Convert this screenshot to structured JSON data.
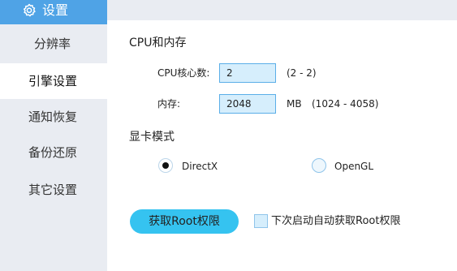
{
  "sidebar": {
    "header_title": "设置",
    "header_icon": "gear-icon",
    "items": [
      {
        "label": "分辨率",
        "active": false
      },
      {
        "label": "引擎设置",
        "active": true
      },
      {
        "label": "通知恢复",
        "active": false
      },
      {
        "label": "备份还原",
        "active": false
      },
      {
        "label": "其它设置",
        "active": false
      }
    ]
  },
  "cpu_memory": {
    "section_title": "CPU和内存",
    "cpu_label": "CPU核心数:",
    "cpu_value": "2",
    "cpu_range": "(2 - 2)",
    "mem_label": "内存:",
    "mem_value": "2048",
    "mem_unit": "MB",
    "mem_range": "(1024 - 4058)"
  },
  "graphics": {
    "section_title": "显卡模式",
    "options": [
      {
        "label": "DirectX",
        "checked": true
      },
      {
        "label": "OpenGL",
        "checked": false
      }
    ]
  },
  "root": {
    "button_label": "获取Root权限",
    "checkbox_label": "下次启动自动获取Root权限",
    "checkbox_checked": false
  },
  "colors": {
    "accent": "#4fa3e6",
    "button": "#35c3f0",
    "sidebar_bg": "#e9ecf2",
    "input_bg": "#d6eefc"
  }
}
